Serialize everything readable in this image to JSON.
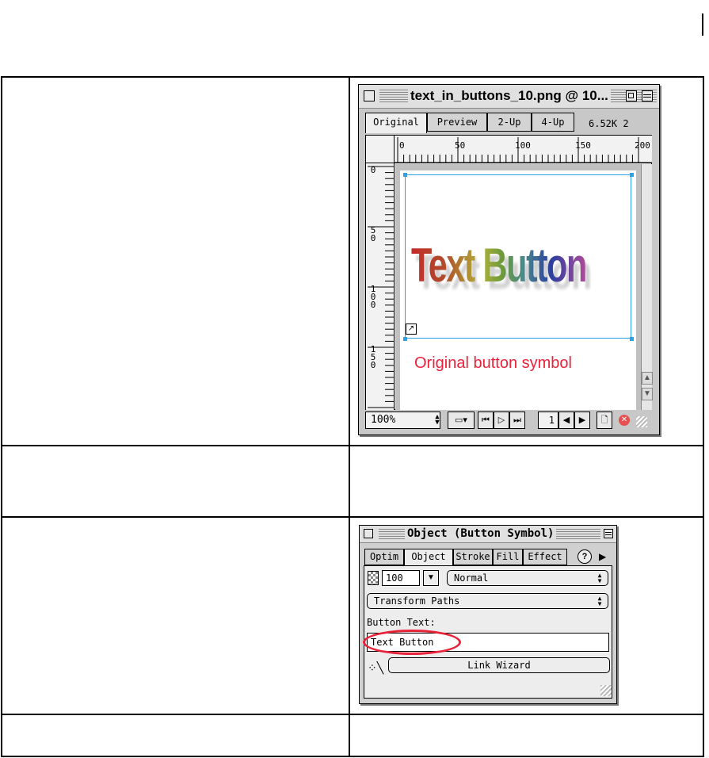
{
  "window1": {
    "title": "text_in_buttons_10.png @ 10...",
    "tabs": [
      "Original",
      "Preview",
      "2-Up",
      "4-Up"
    ],
    "file_size": "6.52K 2",
    "ruler_h": [
      "0",
      "50",
      "100",
      "150",
      "200"
    ],
    "ruler_v": [
      "0",
      "50",
      "100",
      "150"
    ],
    "button_art_text": "Text Button",
    "caption": "Original button symbol",
    "zoom": "100%",
    "frame": "1"
  },
  "window2": {
    "title": "Object (Button Symbol)",
    "tabs": [
      "Optim",
      "Object",
      "Stroke",
      "Fill",
      "Effect"
    ],
    "help": "?",
    "opacity_value": "100",
    "blend_mode": "Normal",
    "transform": "Transform Paths",
    "button_text_label": "Button Text:",
    "button_text_value": "Text Button",
    "link_wizard": "Link Wizard"
  },
  "colors": {
    "selection": "#2aa3e6",
    "annotation_red": "#e8233a"
  }
}
